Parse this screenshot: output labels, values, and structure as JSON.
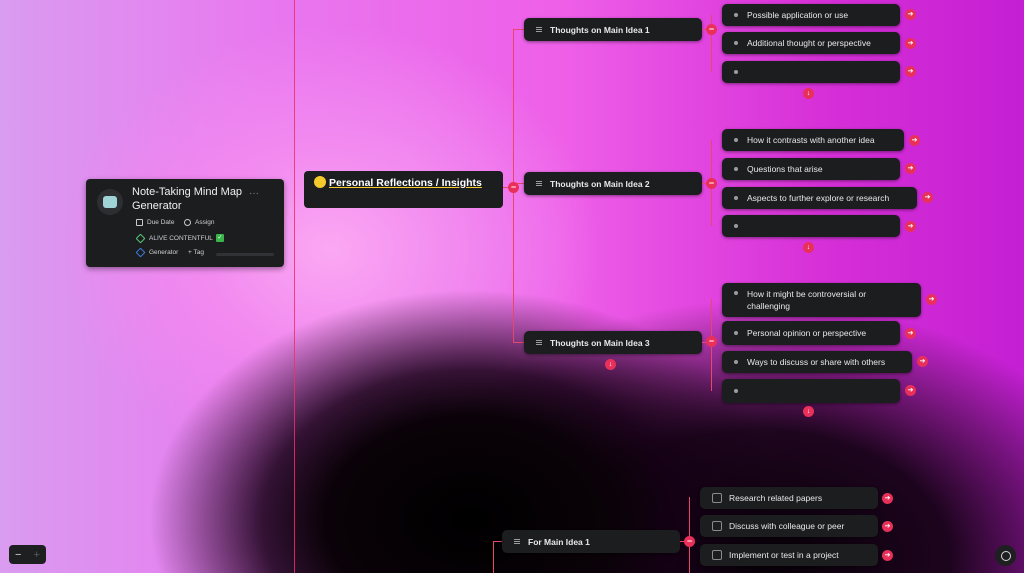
{
  "card": {
    "title": "Note-Taking Mind Map Generator",
    "due_date": "Due Date",
    "assign": "Assign",
    "tag1": "ALIVE CONTENTFUL",
    "tag2": "Generator",
    "add_tag": "+ Tag",
    "more": "···"
  },
  "main_node": {
    "label": "Personal Reflections / Insights"
  },
  "branches": [
    {
      "label": "Thoughts on Main Idea 1",
      "children": [
        "Possible application or use",
        "Additional thought or perspective",
        ""
      ]
    },
    {
      "label": "Thoughts on Main Idea 2",
      "children": [
        "How it contrasts with another idea",
        "Questions that arise",
        "Aspects to further explore or research",
        ""
      ]
    },
    {
      "label": "Thoughts on Main Idea 3",
      "children": [
        "How it might be controversial or challenging",
        "Personal opinion or perspective",
        "Ways to discuss or share with others",
        ""
      ]
    }
  ],
  "lower_branch": {
    "label": "For Main Idea 1",
    "children": [
      "Research related papers",
      "Discuss with colleague or peer",
      "Implement or test in a project"
    ]
  },
  "zoom": {
    "minus": "−",
    "plus": "+"
  },
  "colors": {
    "accent": "#e8305a",
    "node_bg": "#1b1d1f"
  }
}
